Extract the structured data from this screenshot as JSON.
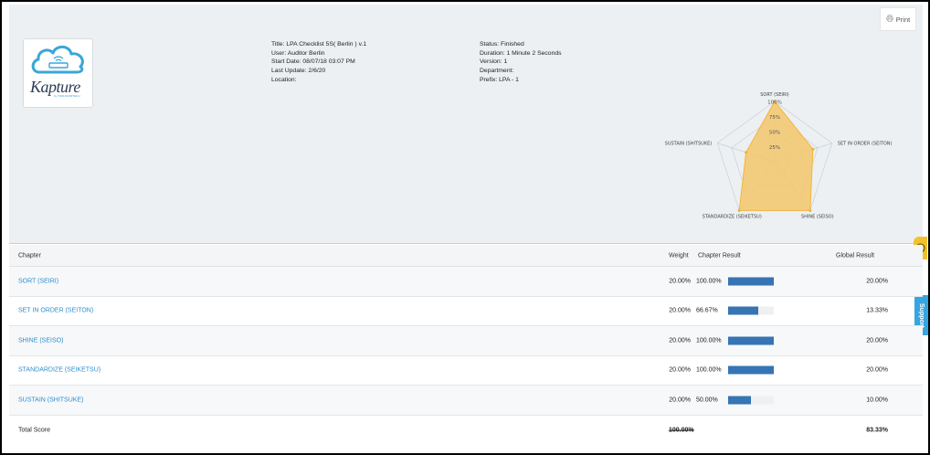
{
  "header": {
    "print_label": "Print",
    "logo": {
      "text": "Kapture",
      "sub": "by TOOLSFORTECH"
    },
    "info_left": [
      "Title: LPA Checklist 5S( Berlin ) v.1",
      "User: Auditor Berlin",
      "Start Date: 08/07/18 03:07 PM",
      "Last Update: 2/6/20",
      "Location:"
    ],
    "info_right": [
      "Status: Finished",
      "Duration: 1 Minute 2 Seconds",
      "Version: 1",
      "Department:",
      "Prefix: LPA - 1"
    ]
  },
  "radar": {
    "axes": [
      "SORT (SEIRI)",
      "SET IN ORDER (SEITON)",
      "SHINE (SEISO)",
      "STANDARDIZE (SEIKETSU)",
      "SUSTAIN (SHITSUKE)"
    ],
    "ticks": [
      "25%",
      "50%",
      "75%",
      "100%"
    ],
    "values": [
      100,
      66.67,
      100,
      100,
      50
    ],
    "fill": "#f4c76b",
    "stroke": "#f2b53a"
  },
  "table": {
    "headers": {
      "chapter": "Chapter",
      "weight": "Weight",
      "chapter_result": "Chapter Result",
      "global_result": "Global Result"
    },
    "rows": [
      {
        "chapter": "SORT (SEIRI)",
        "weight": "20.00%",
        "result": "100.00%",
        "progress": 1.0,
        "global": "20.00%"
      },
      {
        "chapter": "SET IN ORDER (SEITON)",
        "weight": "20.00%",
        "result": "66.67%",
        "progress": 0.6667,
        "global": "13.33%"
      },
      {
        "chapter": "SHINE (SEISO)",
        "weight": "20.00%",
        "result": "100.00%",
        "progress": 1.0,
        "global": "20.00%"
      },
      {
        "chapter": "STANDARDIZE (SEIKETSU)",
        "weight": "20.00%",
        "result": "100.00%",
        "progress": 1.0,
        "global": "20.00%"
      },
      {
        "chapter": "SUSTAIN (SHITSUKE)",
        "weight": "20.00%",
        "result": "50.00%",
        "progress": 0.5,
        "global": "10.00%"
      }
    ],
    "total": {
      "label": "Total Score",
      "weight": "100.00%",
      "global": "83.33%"
    }
  },
  "side_tabs": {
    "support_label": "Support"
  },
  "colors": {
    "accent": "#2b8fcf",
    "bar": "#3674b3",
    "support": "#35a6e0",
    "feedback": "#f2c12e"
  }
}
